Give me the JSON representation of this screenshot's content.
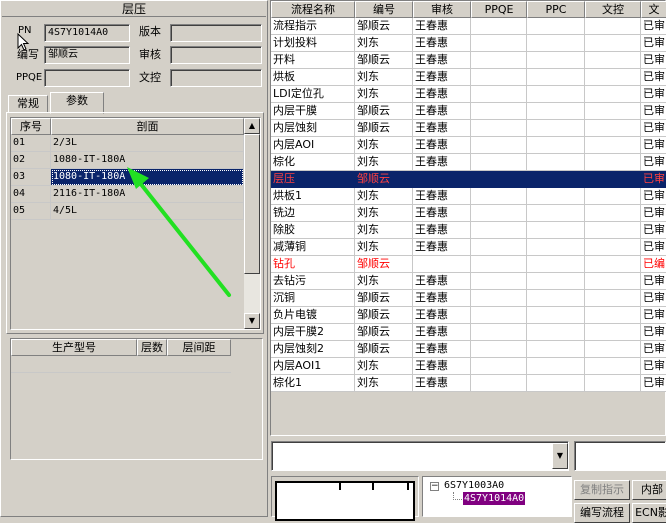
{
  "left_panel": {
    "title": "层压",
    "fields": {
      "pn_label": "PN",
      "pn_value": "4S7Y1014A0",
      "version_label": "版本",
      "version_value": "",
      "author_label": "编写",
      "author_value": "邹顺云",
      "review_label": "审核",
      "review_value": "",
      "ppqe_label": "PPQE",
      "ppqe_value": "",
      "doc_label": "文控",
      "doc_value": ""
    },
    "tabs": [
      "常规",
      "参数"
    ],
    "section_table": {
      "headers": [
        "序号",
        "剖面"
      ],
      "rows": [
        {
          "no": "01",
          "section": "2/3L"
        },
        {
          "no": "02",
          "section": "1080-IT-180A"
        },
        {
          "no": "03",
          "section": "1080-IT-180A"
        },
        {
          "no": "04",
          "section": "2116-IT-180A"
        },
        {
          "no": "05",
          "section": "4/5L"
        }
      ]
    },
    "production_table": {
      "headers": [
        "生产型号",
        "层数",
        "层间距"
      ]
    }
  },
  "process_table": {
    "headers": [
      "流程名称",
      "编号",
      "审核",
      "PPQE",
      "PPC",
      "文控",
      "文"
    ],
    "rows": [
      {
        "name": "流程指示",
        "code": "邹顺云",
        "review": "王春惠",
        "status": "已审",
        "style": "normal"
      },
      {
        "name": "计划投料",
        "code": "刘东",
        "review": "王春惠",
        "status": "已审",
        "style": "normal"
      },
      {
        "name": "开料",
        "code": "邹顺云",
        "review": "王春惠",
        "status": "已审",
        "style": "normal"
      },
      {
        "name": "烘板",
        "code": "刘东",
        "review": "王春惠",
        "status": "已审",
        "style": "normal"
      },
      {
        "name": "LDI定位孔",
        "code": "刘东",
        "review": "王春惠",
        "status": "已审",
        "style": "normal"
      },
      {
        "name": "内层干膜",
        "code": "邹顺云",
        "review": "王春惠",
        "status": "已审",
        "style": "normal"
      },
      {
        "name": "内层蚀刻",
        "code": "邹顺云",
        "review": "王春惠",
        "status": "已审",
        "style": "normal"
      },
      {
        "name": "内层AOI",
        "code": "刘东",
        "review": "王春惠",
        "status": "已审",
        "style": "normal"
      },
      {
        "name": "棕化",
        "code": "刘东",
        "review": "王春惠",
        "status": "已审",
        "style": "normal"
      },
      {
        "name": "层压",
        "code": "邹顺云",
        "review": "",
        "status": "已审",
        "style": "selected"
      },
      {
        "name": "烘板1",
        "code": "刘东",
        "review": "王春惠",
        "status": "已审",
        "style": "normal"
      },
      {
        "name": "铣边",
        "code": "刘东",
        "review": "王春惠",
        "status": "已审",
        "style": "normal"
      },
      {
        "name": "除胶",
        "code": "刘东",
        "review": "王春惠",
        "status": "已审",
        "style": "normal"
      },
      {
        "name": "减薄铜",
        "code": "刘东",
        "review": "王春惠",
        "status": "已审",
        "style": "normal"
      },
      {
        "name": "钻孔",
        "code": "邹顺云",
        "review": "",
        "status": "已编",
        "style": "red"
      },
      {
        "name": "去钻污",
        "code": "刘东",
        "review": "王春惠",
        "status": "已审",
        "style": "normal"
      },
      {
        "name": "沉铜",
        "code": "邹顺云",
        "review": "王春惠",
        "status": "已审",
        "style": "normal"
      },
      {
        "name": "负片电镀",
        "code": "邹顺云",
        "review": "王春惠",
        "status": "已审",
        "style": "normal"
      },
      {
        "name": "内层干膜2",
        "code": "邹顺云",
        "review": "王春惠",
        "status": "已审",
        "style": "normal"
      },
      {
        "name": "内层蚀刻2",
        "code": "邹顺云",
        "review": "王春惠",
        "status": "已审",
        "style": "normal"
      },
      {
        "name": "内层AOI1",
        "code": "刘东",
        "review": "王春惠",
        "status": "已审",
        "style": "normal"
      },
      {
        "name": "棕化1",
        "code": "刘东",
        "review": "王春惠",
        "status": "已审",
        "style": "normal"
      }
    ]
  },
  "bottom": {
    "tree_parent": "6S7Y1003A0",
    "tree_child": "4S7Y1014A0",
    "buttons": [
      "复制指示",
      "内部",
      "编写流程",
      "ECN影"
    ]
  },
  "colors": {
    "selection": "#0a246a",
    "red_text": "#ff0000",
    "arrow": "#22e022",
    "tree_highlight": "#800080"
  }
}
